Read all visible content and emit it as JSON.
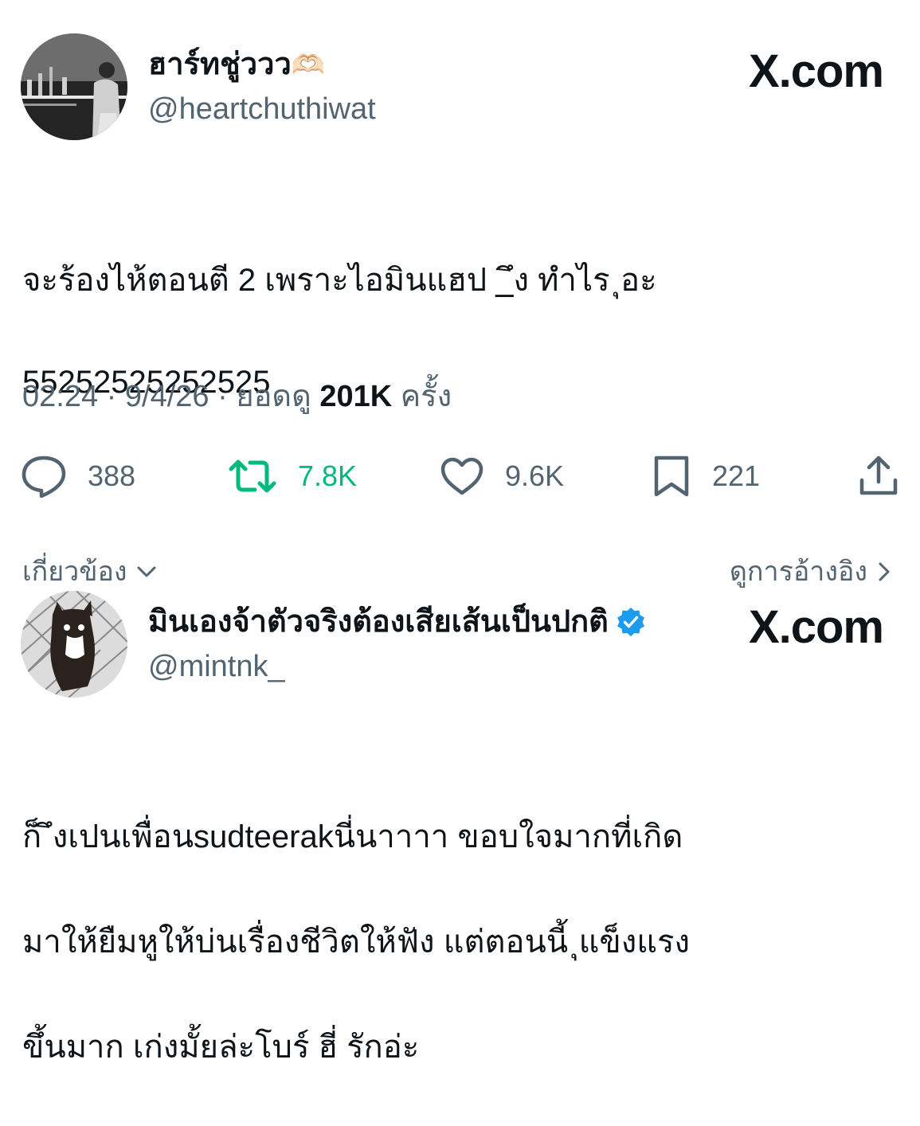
{
  "brand_label": "X.com",
  "tweet": {
    "author_name": "ฮาร์ทชู่ววว",
    "author_emoji": "🫶🏻",
    "handle": "@heartchuthiwat",
    "text_line1": "จะร้องไห้ตอนตี 2 เพราะไอมินแฮป _ึง ทำไร ุอะ",
    "text_line2": "55252525252525",
    "time": "02:24",
    "date": "9/4/26",
    "views_prefix": "ยอดดู",
    "views_count": "201K",
    "views_suffix": "ครั้ง",
    "actions": {
      "replies": "388",
      "reposts": "7.8K",
      "likes": "9.6K",
      "bookmarks": "221"
    }
  },
  "related_bar": {
    "left_label": "เกี่ยวข้อง",
    "right_label": "ดูการอ้างอิง"
  },
  "quoted": {
    "author_name": "มินเองจ้าตัวจริงต้องเสียเส้นเป็นปกติ",
    "verified": true,
    "handle": "@mintnk_",
    "text_line1": "ก็ ึงเปนเพื่อนsudteerakนี่นาาาา ขอบใจมากที่เกิด",
    "text_line2": "มาให้ยืมหูให้บ่นเรื่องชีวิตให้ฟัง แต่ตอนนี้ ุแข็งแรง",
    "text_line3": "ขึ้นมาก เก่งมั้ยล่ะโบร์ ฮี่ รักอ่ะ"
  },
  "colors": {
    "text": "#0f1419",
    "secondary": "#536471",
    "repost_green": "#00ba7c",
    "verified_blue": "#1d9bf0"
  },
  "icons": [
    "reply-icon",
    "repost-icon",
    "like-icon",
    "bookmark-icon",
    "share-icon",
    "chevron-down-icon",
    "chevron-right-icon",
    "verified-badge-icon"
  ]
}
